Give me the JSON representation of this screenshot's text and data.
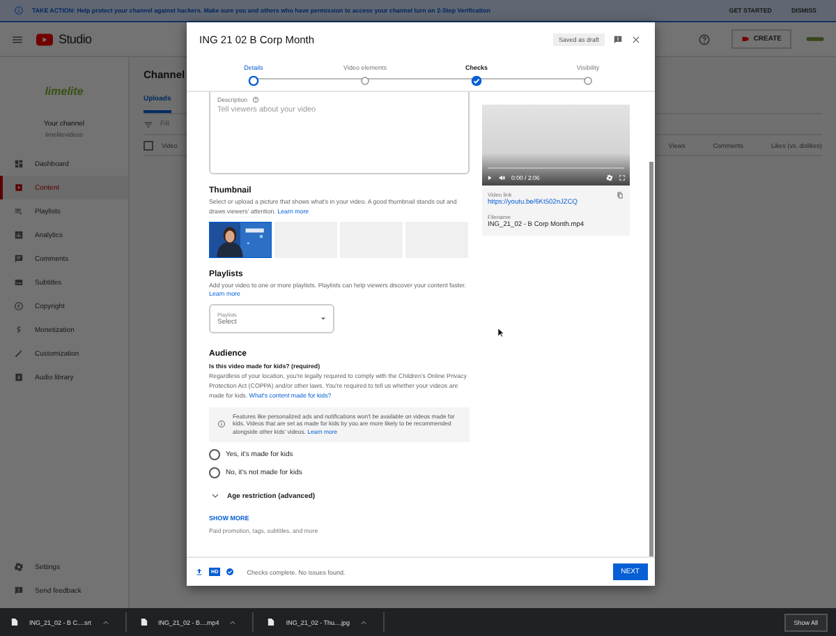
{
  "banner": {
    "text": "TAKE ACTION: Help protect your channel against hackers. Make sure you and others who have permission to access your channel turn on 2-Step Verification",
    "actions": [
      "GET STARTED",
      "DISMISS"
    ]
  },
  "header": {
    "logo_text": "Studio",
    "create_label": "CREATE"
  },
  "sidebar": {
    "channel_logo_text": "limelite",
    "channel_title": "Your channel",
    "channel_handle": "limelitevideos",
    "items": [
      {
        "label": "Dashboard",
        "selected": false
      },
      {
        "label": "Content",
        "selected": true
      },
      {
        "label": "Playlists",
        "selected": false
      },
      {
        "label": "Analytics",
        "selected": false
      },
      {
        "label": "Comments",
        "selected": false
      },
      {
        "label": "Subtitles",
        "selected": false
      },
      {
        "label": "Copyright",
        "selected": false
      },
      {
        "label": "Monetization",
        "selected": false
      },
      {
        "label": "Customization",
        "selected": false
      },
      {
        "label": "Audio library",
        "selected": false
      }
    ],
    "bottom_items": [
      {
        "label": "Settings"
      },
      {
        "label": "Send feedback"
      }
    ]
  },
  "main": {
    "title": "Channel",
    "tabs": [
      {
        "label": "Uploads",
        "selected": true
      }
    ],
    "filter_text": "Filt",
    "select_all_checked": false,
    "columns": [
      "Video",
      "Views",
      "Comments",
      "Likes (vs. dislikes)"
    ]
  },
  "dialog": {
    "title": "ING 21 02 B Corp Month",
    "draft_badge": "Saved as draft",
    "steps": [
      {
        "label": "Details",
        "selected": true,
        "done": false
      },
      {
        "label": "Video elements",
        "selected": false,
        "done": false
      },
      {
        "label": "Checks",
        "selected": false,
        "done": true
      },
      {
        "label": "Visibility",
        "selected": false,
        "done": false
      }
    ],
    "description": {
      "label": "Description",
      "placeholder": "Tell viewers about your video"
    },
    "thumbnail": {
      "heading": "Thumbnail",
      "text": "Select or upload a picture that shows what's in your video. A good thumbnail stands out and draws viewers' attention.",
      "link": "Learn more",
      "slots": [
        {
          "kind": "picture"
        },
        {
          "kind": "blank"
        },
        {
          "kind": "blank"
        },
        {
          "kind": "blank"
        }
      ]
    },
    "playlists": {
      "heading": "Playlists",
      "text": "Add your video to one or more playlists. Playlists can help viewers discover your content faster.",
      "link": "Learn more",
      "field_label": "Playlists",
      "field_value": "Select"
    },
    "audience": {
      "heading": "Audience",
      "question": "Is this video made for kids? (required)",
      "text": "Regardless of your location, you're legally required to comply with the Children's Online Privacy Protection Act (COPPA) and/or other laws. You're required to tell us whether your videos are made for kids.",
      "link": "What's content made for kids?",
      "notice": "Features like personalized ads and notifications won't be available on videos made for kids. Videos that are set as made for kids by you are more likely to be recommended alongside other kids' videos.",
      "notice_link": "Learn more",
      "options": [
        {
          "label": "Yes, it's made for kids",
          "selected": false
        },
        {
          "label": "No, it's not made for kids",
          "selected": false
        }
      ]
    },
    "age_restriction": {
      "label": "Age restriction (advanced)",
      "expanded": false
    },
    "show_more": {
      "label": "SHOW MORE",
      "text": "Paid promotion, tags, subtitles, and more"
    },
    "preview": {
      "time": "0:00 / 2:06",
      "link_label": "Video link",
      "link": "https://youtu.be/6Kt502nJZCQ",
      "filename_label": "Filename",
      "filename": "ING_21_02 - B Corp Month.mp4"
    },
    "footer": {
      "hd_badge": "HD",
      "status": "Checks complete. No issues found.",
      "next": "NEXT"
    }
  },
  "downloads": {
    "files": [
      "ING_21_02 - B C....srt",
      "ING_21_02 - B....mp4",
      "ING_21_02 - Thu....jpg"
    ],
    "show_all": "Show All"
  }
}
